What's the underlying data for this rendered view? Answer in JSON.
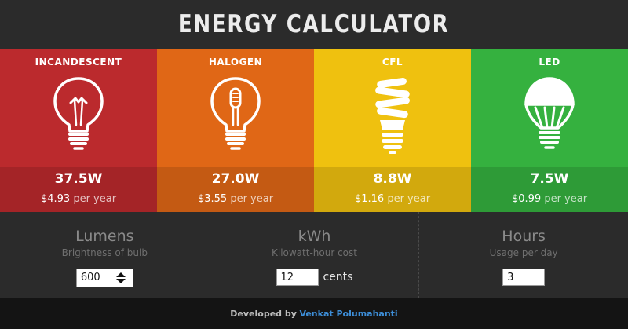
{
  "header": {
    "title": "ENERGY CALCULATOR"
  },
  "bulbs": [
    {
      "name": "INCANDESCENT",
      "watts": "37.5W",
      "cost": "$4.93",
      "per": "per year",
      "color": "#bb2a2d",
      "icon": "incandescent-bulb-icon"
    },
    {
      "name": "HALOGEN",
      "watts": "27.0W",
      "cost": "$3.55",
      "per": "per year",
      "color": "#e06716",
      "icon": "halogen-bulb-icon"
    },
    {
      "name": "CFL",
      "watts": "8.8W",
      "cost": "$1.16",
      "per": "per year",
      "color": "#efc10f",
      "icon": "cfl-bulb-icon"
    },
    {
      "name": "LED",
      "watts": "7.5W",
      "cost": "$0.99",
      "per": "per year",
      "color": "#35b13f",
      "icon": "led-bulb-icon"
    }
  ],
  "controls": {
    "lumens": {
      "label": "Lumens",
      "sub": "Brightness of bulb",
      "value": "600"
    },
    "kwh": {
      "label": "kWh",
      "sub": "Kilowatt-hour cost",
      "value": "12",
      "unit": "cents"
    },
    "hours": {
      "label": "Hours",
      "sub": "Usage per day",
      "value": "3"
    }
  },
  "footer": {
    "prefix": "Developed by",
    "author": "Venkat Polumahanti"
  }
}
